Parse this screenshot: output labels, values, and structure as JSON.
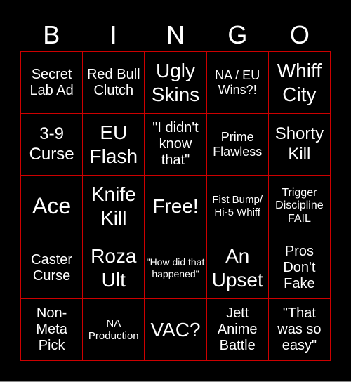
{
  "header": {
    "letters": [
      "B",
      "I",
      "N",
      "G",
      "O"
    ]
  },
  "colors": {
    "background": "#000000",
    "grid_border": "#cc0000",
    "text": "#ffffff"
  },
  "cells": [
    [
      "Secret Lab Ad",
      "Red Bull Clutch",
      "Ugly Skins",
      "NA / EU Wins?!",
      "Whiff City"
    ],
    [
      "3-9 Curse",
      "EU Flash",
      "\"I didn't know that\"",
      "Prime Flawless",
      "Shorty Kill"
    ],
    [
      "Ace",
      "Knife Kill",
      "Free!",
      "Fist Bump/ Hi-5 Whiff",
      "Trigger Discipline FAIL"
    ],
    [
      "Caster Curse",
      "Roza Ult",
      "\"How did that happened\"",
      "An Upset",
      "Pros Don't Fake"
    ],
    [
      "Non-Meta Pick",
      "NA Production",
      "VAC?",
      "Jett Anime Battle",
      "\"That was so easy\""
    ]
  ]
}
